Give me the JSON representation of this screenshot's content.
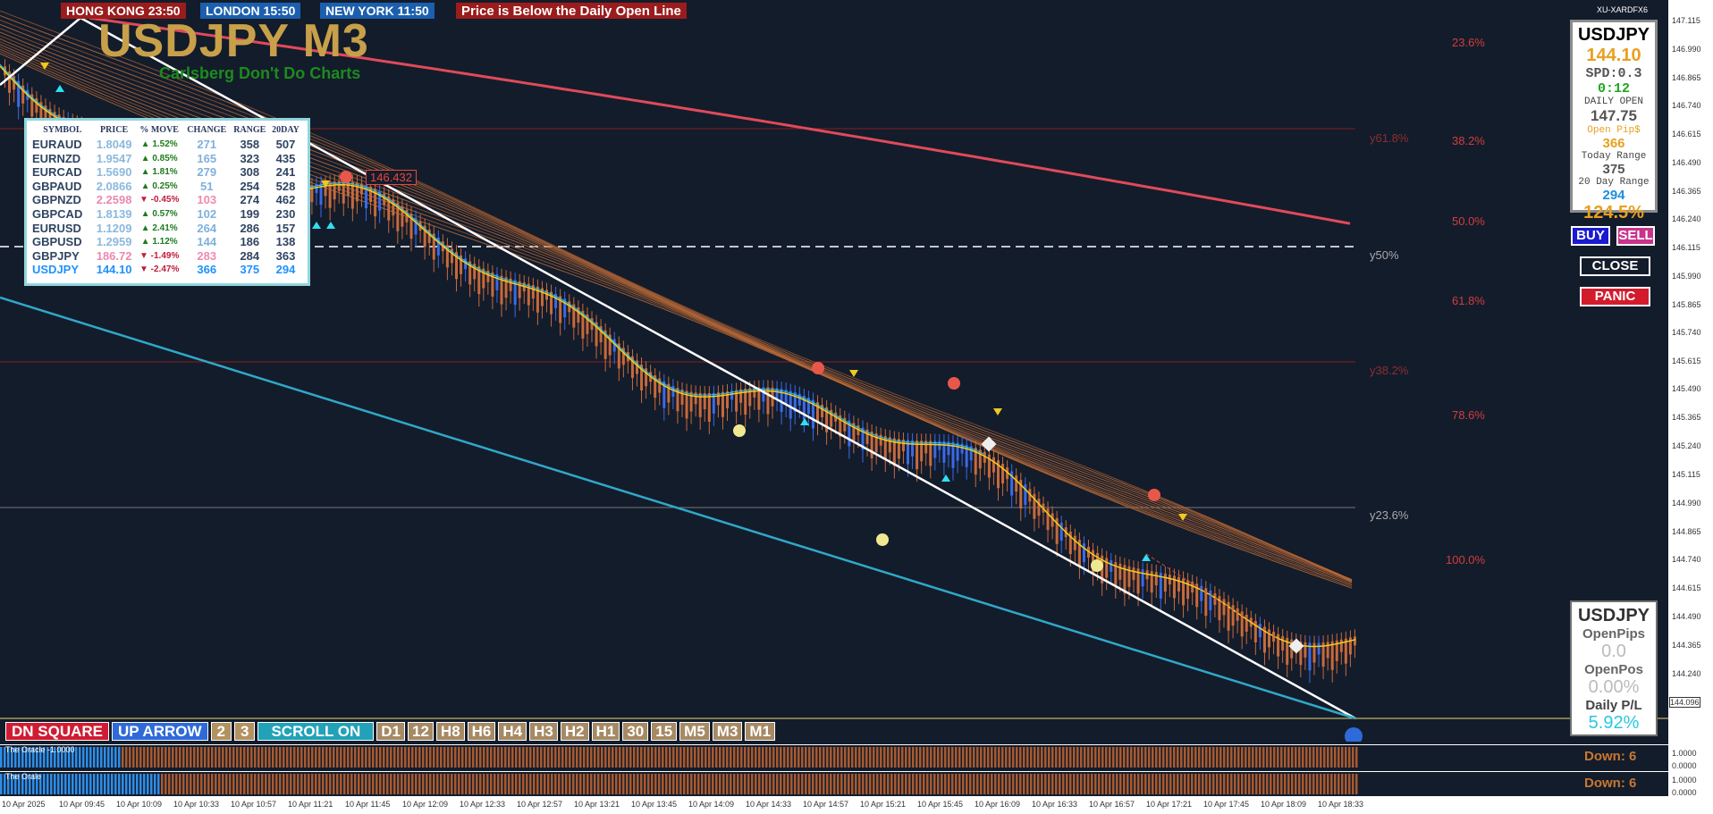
{
  "clocks": {
    "hong_kong": "HONG KONG 23:50",
    "london": "LONDON  15:50",
    "new_york": "NEW YORK  11:50",
    "alert": "Price is Below the Daily Open Line"
  },
  "title": {
    "symbol_tf": "USDJPY M3",
    "tagline": "Carlsberg Don't Do Charts"
  },
  "broker": "XU-XARDFX6",
  "price_note": "146.432",
  "symbol_table": {
    "headers": [
      "SYMBOL",
      "PRICE",
      "% MOVE",
      "CHANGE",
      "RANGE",
      "20DAY"
    ],
    "rows": [
      {
        "symbol": "EURAUD",
        "price": "1.8049",
        "move": "▲ 1.52%",
        "change": "271",
        "range": "358",
        "day20": "507",
        "dir": "up"
      },
      {
        "symbol": "EURNZD",
        "price": "1.9547",
        "move": "▲ 0.85%",
        "change": "165",
        "range": "323",
        "day20": "435",
        "dir": "up"
      },
      {
        "symbol": "EURCAD",
        "price": "1.5690",
        "move": "▲ 1.81%",
        "change": "279",
        "range": "308",
        "day20": "241",
        "dir": "up"
      },
      {
        "symbol": "GBPAUD",
        "price": "2.0866",
        "move": "▲ 0.25%",
        "change": "51",
        "range": "254",
        "day20": "528",
        "dir": "up"
      },
      {
        "symbol": "GBPNZD",
        "price": "2.2598",
        "move": "▼ -0.45%",
        "change": "103",
        "range": "274",
        "day20": "462",
        "dir": "down"
      },
      {
        "symbol": "GBPCAD",
        "price": "1.8139",
        "move": "▲ 0.57%",
        "change": "102",
        "range": "199",
        "day20": "230",
        "dir": "up"
      },
      {
        "symbol": "EURUSD",
        "price": "1.1209",
        "move": "▲ 2.41%",
        "change": "264",
        "range": "286",
        "day20": "157",
        "dir": "up"
      },
      {
        "symbol": "GBPUSD",
        "price": "1.2959",
        "move": "▲ 1.12%",
        "change": "144",
        "range": "186",
        "day20": "138",
        "dir": "up"
      },
      {
        "symbol": "GBPJPY",
        "price": "186.72",
        "move": "▼ -1.49%",
        "change": "283",
        "range": "284",
        "day20": "363",
        "dir": "down"
      },
      {
        "symbol": "USDJPY",
        "price": "144.10",
        "move": "▼ -2.47%",
        "change": "366",
        "range": "375",
        "day20": "294",
        "dir": "down",
        "highlight": true
      }
    ]
  },
  "info_panel": {
    "symbol": "USDJPY",
    "price": "144.10",
    "spread": "SPD:0.3",
    "timer": "0:12",
    "daily_open_label": "DAILY OPEN",
    "daily_open": "147.75",
    "open_pips_label": "Open Pip$",
    "open_pips": "366",
    "today_range_label": "Today Range",
    "today_range": "375",
    "day20_range_label": "20 Day Range",
    "day20_range": "294",
    "pct": "124.5%"
  },
  "trade_buttons": {
    "buy": "BUY",
    "sell": "SELL",
    "close": "CLOSE",
    "panic": "PANIC"
  },
  "pips_panel": {
    "symbol": "USDJPY",
    "open_pips_label": "OpenPips",
    "open_pips": "0.0",
    "open_pos_label": "OpenPos",
    "open_pos": "0.00%",
    "daily_pl_label": "Daily P/L",
    "daily_pl": "5.92%"
  },
  "toolbar": {
    "dn_square": "DN SQUARE",
    "up_arrow": "UP ARROW",
    "two": "2",
    "three": "3",
    "scroll": "SCROLL ON",
    "timeframes": [
      "D1",
      "12",
      "H8",
      "H6",
      "H4",
      "H3",
      "H2",
      "H1",
      "30",
      "15",
      "M5",
      "M3",
      "M1"
    ]
  },
  "fib_levels": [
    {
      "label": "23.6%",
      "style": "bright"
    },
    {
      "label": "38.2%",
      "style": "bright"
    },
    {
      "label": "50.0%",
      "style": "bright"
    },
    {
      "label": "61.8%",
      "style": "bright"
    },
    {
      "label": "78.6%",
      "style": "bright"
    },
    {
      "label": "100.0%",
      "style": "bright"
    }
  ],
  "y_labels": {
    "y618": "y61.8%",
    "y50": "y50%",
    "y382": "y38.2%",
    "y236": "y23.6%"
  },
  "price_axis": [
    "147.115",
    "146.990",
    "146.865",
    "146.740",
    "146.615",
    "146.490",
    "146.365",
    "146.240",
    "146.115",
    "145.990",
    "145.865",
    "145.740",
    "145.615",
    "145.490",
    "145.365",
    "145.240",
    "145.115",
    "144.990",
    "144.865",
    "144.740",
    "144.615",
    "144.490",
    "144.365",
    "144.240",
    "144.096",
    "1.0000",
    "0.0000",
    "1.0000",
    "0.0000"
  ],
  "current_price": "144.096",
  "indicators": [
    {
      "label": "The Oracle -1.0000",
      "down": "Down: 6"
    },
    {
      "label": "The Orale",
      "down": "Down: 6"
    }
  ],
  "time_axis": [
    "10 Apr 2025",
    "10 Apr 09:45",
    "10 Apr 10:09",
    "10 Apr 10:33",
    "10 Apr 10:57",
    "10 Apr 11:21",
    "10 Apr 11:45",
    "10 Apr 12:09",
    "10 Apr 12:33",
    "10 Apr 12:57",
    "10 Apr 13:21",
    "10 Apr 13:45",
    "10 Apr 14:09",
    "10 Apr 14:33",
    "10 Apr 14:57",
    "10 Apr 15:21",
    "10 Apr 15:45",
    "10 Apr 16:09",
    "10 Apr 16:33",
    "10 Apr 16:57",
    "10 Apr 17:21",
    "10 Apr 17:45",
    "10 Apr 18:09",
    "10 Apr 18:33"
  ],
  "colors": {
    "background": "#131c2b",
    "bear_candle": "#c86a3a",
    "bull_candle": "#3a6ae8",
    "ma_fast": "#f0d020",
    "ma_signal": "#30c8e8",
    "ma_slow": "#e04a5a",
    "trend_white": "#ffffff",
    "trend_cyan": "#30a8c8"
  }
}
